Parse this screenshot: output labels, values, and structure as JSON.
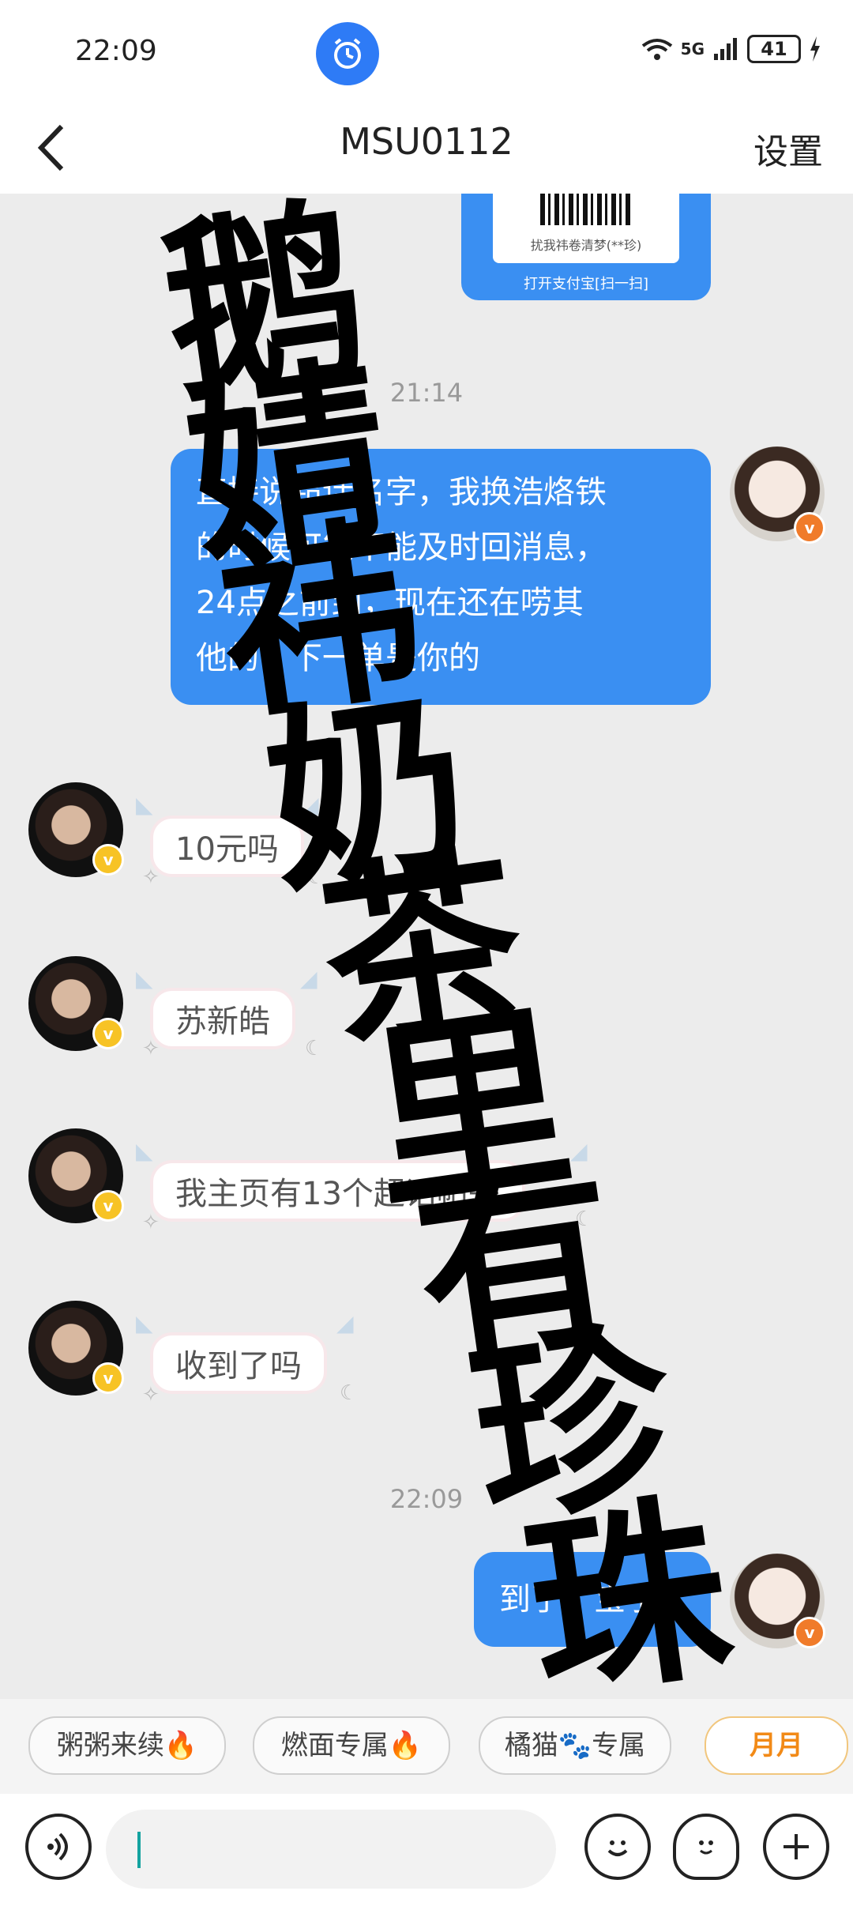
{
  "status_bar": {
    "time": "22:09",
    "battery": "41",
    "network": "5G",
    "icons": [
      "alarm-icon",
      "wifi-icon",
      "signal-icon",
      "battery-icon",
      "charging-icon"
    ]
  },
  "header": {
    "title": "MSU0112",
    "settings_label": "设置"
  },
  "qr_card": {
    "caption": "扰我祎卷清梦(**珍)",
    "footer": "打开支付宝[扫一扫]"
  },
  "timestamps": [
    "21:14",
    "22:09"
  ],
  "messages": [
    {
      "side": "right",
      "text_lines": [
        "直接说超话名字，我换浩烙铁",
        "的时候可能不能及时回消息，",
        "24点之前到，现在还在唠其",
        "他的，下一单是你的"
      ]
    },
    {
      "side": "left",
      "text": "10元吗"
    },
    {
      "side": "left",
      "text": "苏新皓"
    },
    {
      "side": "left",
      "text": "我主页有13个超话帖子"
    },
    {
      "side": "left",
      "text": "收到了吗"
    },
    {
      "side": "right",
      "text": "到了，宝子"
    }
  ],
  "watermark": [
    "鹅",
    "婧",
    "祎",
    "奶",
    "茶",
    "里",
    "有",
    "珍",
    "珠"
  ],
  "quick_tags": [
    "粥粥来续🔥",
    "燃面专属🔥",
    "橘猫🐾专属",
    "月月"
  ],
  "input_bar": {
    "value": "",
    "icons": [
      "voice-icon",
      "emoji-icon",
      "sticker-icon",
      "plus-icon"
    ]
  },
  "colors": {
    "accent": "#3a8ff2",
    "background": "#ececec",
    "caret": "#14a3a0"
  }
}
